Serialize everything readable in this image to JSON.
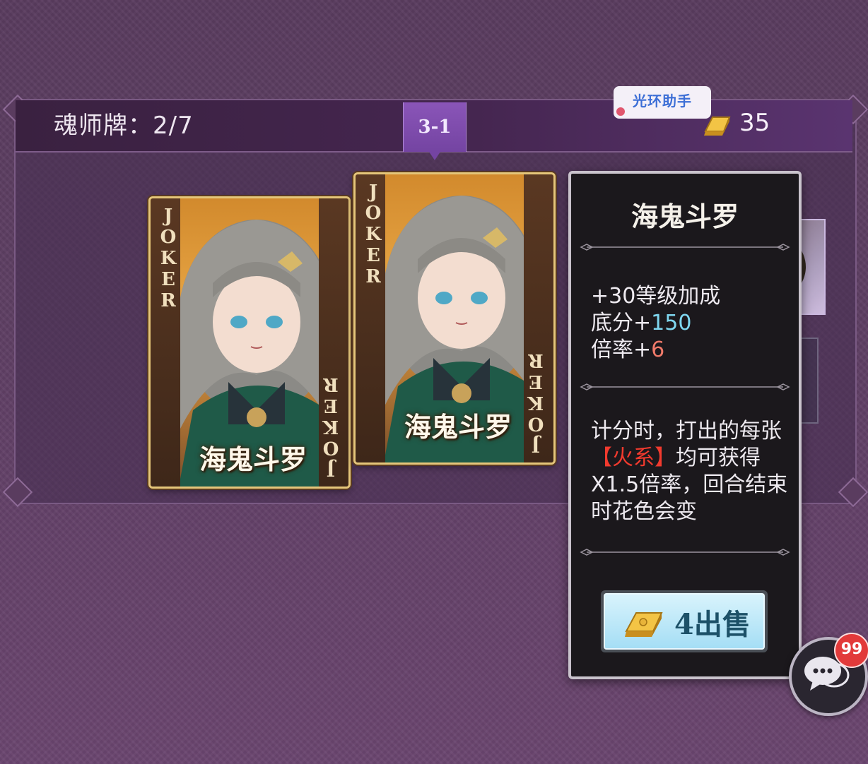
{
  "header": {
    "title": "魂师牌：2/7",
    "stage_tab": "3-1",
    "assistant_label": "光环助手",
    "gold_amount": "35"
  },
  "cards": [
    {
      "corner_text": "JOKER",
      "name": "海鬼斗罗"
    },
    {
      "corner_text": "JOKER",
      "name": "海鬼斗罗"
    }
  ],
  "tooltip": {
    "title": "海鬼斗罗",
    "stats": [
      {
        "prefix": "+30等级加成",
        "value": ""
      },
      {
        "prefix": "底分+",
        "value": "150"
      },
      {
        "prefix": "倍率+",
        "value": "6"
      }
    ],
    "desc": {
      "part1": "计分时，打出的每张",
      "highlight": "【火系】",
      "part2": "均可获得X1.5倍率，回合结束时花色会变"
    },
    "sell_label": "4出售"
  },
  "chat": {
    "badge": "99"
  },
  "colors": {
    "gold": "#e8b43a",
    "stat_blue": "#7fd7f0",
    "stat_red": "#f07a6a",
    "fire": "#f23a2e",
    "stage_tab": "#7f4cad"
  },
  "icons": {
    "gold": "gold-bar-icon",
    "chat": "chat-bubble-icon"
  }
}
